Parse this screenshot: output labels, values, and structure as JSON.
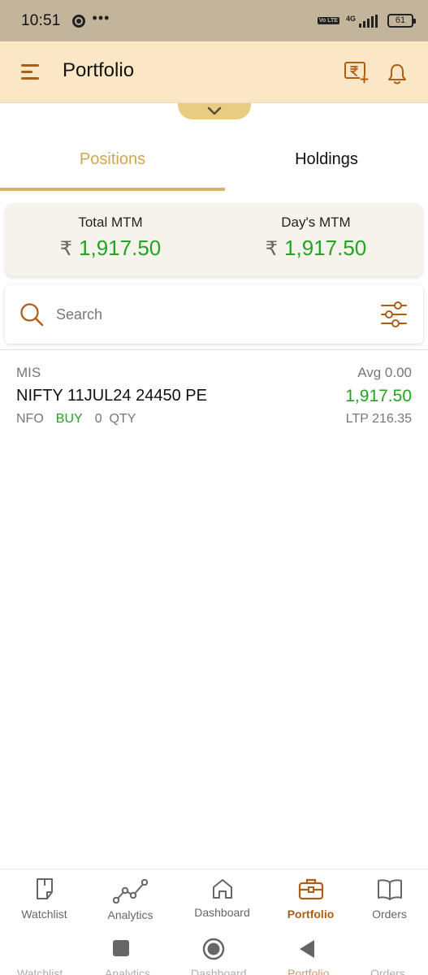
{
  "status_bar": {
    "time": "10:51",
    "more": "•••",
    "volte": "Vo LTE",
    "network": "4G",
    "battery": "61",
    "icons": [
      "chrome-icon",
      "signal-icon",
      "battery-icon"
    ]
  },
  "header": {
    "title": "Portfolio",
    "icons": [
      "menu-icon",
      "add-funds-rupee-icon",
      "bell-icon"
    ]
  },
  "tabs": [
    {
      "label": "Positions",
      "active": true
    },
    {
      "label": "Holdings",
      "active": false
    }
  ],
  "mtm": {
    "total_label": "Total MTM",
    "total_value": "1,917.50",
    "day_label": "Day's MTM",
    "day_value": "1,917.50",
    "currency": "₹"
  },
  "search": {
    "placeholder": "Search",
    "value": ""
  },
  "positions": [
    {
      "product": "MIS",
      "avg": "Avg 0.00",
      "symbol": "NIFTY 11JUL24 24450 PE",
      "pnl": "1,917.50",
      "exchange": "NFO",
      "side": "BUY",
      "qty": "0",
      "qty_label": "QTY",
      "ltp": "LTP 216.35"
    }
  ],
  "bottom_nav": [
    {
      "label": "Watchlist",
      "icon": "bookmark-icon",
      "active": false
    },
    {
      "label": "Analytics",
      "icon": "analytics-icon",
      "active": false
    },
    {
      "label": "Dashboard",
      "icon": "home-icon",
      "active": false
    },
    {
      "label": "Portfolio",
      "icon": "briefcase-icon",
      "active": true
    },
    {
      "label": "Orders",
      "icon": "book-icon",
      "active": false
    }
  ],
  "system_nav": {
    "ghost_labels": [
      "Watchlist",
      "Analytics",
      "Dashboard",
      "Portfolio",
      "Orders"
    ]
  },
  "colors": {
    "accent": "#b05d14",
    "gold": "#d1a64e",
    "profit": "#23a321",
    "header_bg": "#fbe7c5",
    "statusbar_bg": "#c3b59c"
  }
}
